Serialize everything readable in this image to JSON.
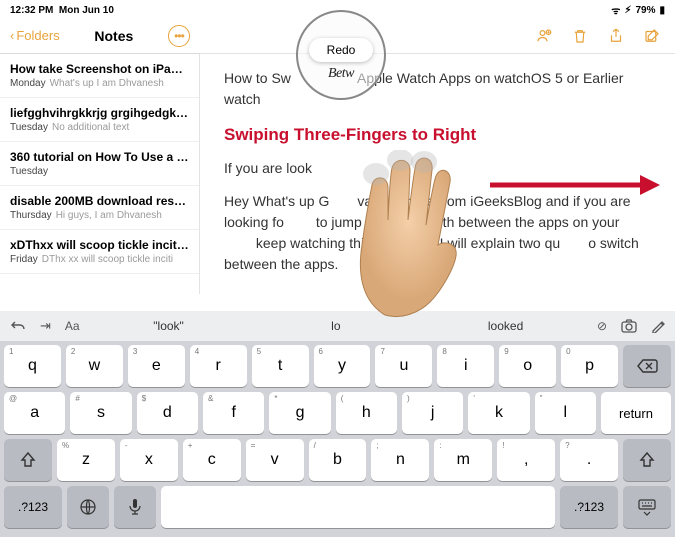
{
  "status": {
    "time": "12:32 PM",
    "date": "Mon Jun 10",
    "battery": "79%"
  },
  "nav": {
    "back": "Folders",
    "title": "Notes"
  },
  "redo": {
    "label": "Redo",
    "sub": "Betw"
  },
  "annotation": "Swiping Three-Fingers to Right",
  "notes": [
    {
      "title": "How take Screenshot on iPad wi…",
      "day": "Monday",
      "sub": "What's up I am Dhvanesh"
    },
    {
      "title": "liefgghvihrgkkrjg grgihgedgkeijg…",
      "day": "Tuesday",
      "sub": "No additional text"
    },
    {
      "title": "360 tutorial on How To Use a Blu…",
      "day": "Tuesday",
      "sub": ""
    },
    {
      "title": "disable 200MB download restric…",
      "day": "Thursday",
      "sub": "Hi guys, I am Dhvanesh"
    },
    {
      "title": "xDThxx will scoop tickle inciting s",
      "day": "Friday",
      "sub": "DThx xx will scoop tickle inciti"
    }
  ],
  "body": {
    "p1a": "How to Sw",
    "p1b": " Apple Watch Apps on watchOS 5 or Earlier watch",
    "p2": "If you are look",
    "p3a": "Hey What's up G",
    "p3b": "vanesh here from iGeeksBlog and if you are looking fo",
    "p3c": " to jump back and forth between the apps on your ",
    "p3d": " keep watching this video and I will explain two qu",
    "p3e": "o switch between the apps."
  },
  "suggestions": {
    "s1": "look",
    "s2": "lo",
    "s3": "looked"
  },
  "keys": {
    "r1": [
      {
        "m": "q",
        "a": "1"
      },
      {
        "m": "w",
        "a": "2"
      },
      {
        "m": "e",
        "a": "3"
      },
      {
        "m": "r",
        "a": "4"
      },
      {
        "m": "t",
        "a": "5"
      },
      {
        "m": "y",
        "a": "6"
      },
      {
        "m": "u",
        "a": "7"
      },
      {
        "m": "i",
        "a": "8"
      },
      {
        "m": "o",
        "a": "9"
      },
      {
        "m": "p",
        "a": "0"
      }
    ],
    "r2": [
      {
        "m": "a",
        "a": "@"
      },
      {
        "m": "s",
        "a": "#"
      },
      {
        "m": "d",
        "a": "$"
      },
      {
        "m": "f",
        "a": "&"
      },
      {
        "m": "g",
        "a": "*"
      },
      {
        "m": "h",
        "a": "("
      },
      {
        "m": "j",
        "a": ")"
      },
      {
        "m": "k",
        "a": "'"
      },
      {
        "m": "l",
        "a": "\""
      }
    ],
    "r3": [
      {
        "m": "z",
        "a": "%"
      },
      {
        "m": "x",
        "a": "-"
      },
      {
        "m": "c",
        "a": "+"
      },
      {
        "m": "v",
        "a": "="
      },
      {
        "m": "b",
        "a": "/"
      },
      {
        "m": "n",
        "a": ";"
      },
      {
        "m": "m",
        "a": ":"
      },
      {
        "m": ",",
        "a": "!"
      },
      {
        "m": ".",
        "a": "?"
      }
    ],
    "n123": ".?123",
    "ret": "return"
  }
}
